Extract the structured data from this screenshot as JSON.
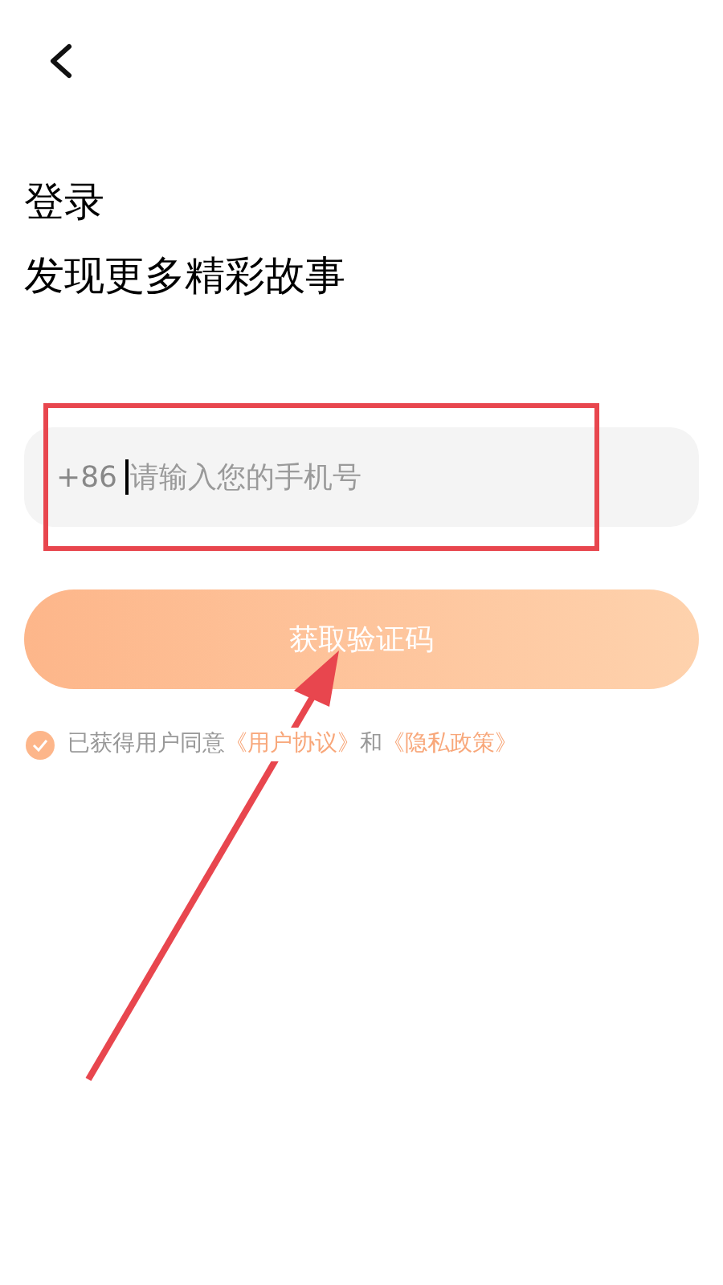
{
  "title": "登录",
  "subtitle": "发现更多精彩故事",
  "phone_field": {
    "prefix": "+86",
    "placeholder": "请输入您的手机号"
  },
  "submit_button": {
    "label": "获取验证码"
  },
  "agreement": {
    "checked": true,
    "parts": [
      {
        "kind": "text",
        "text": "已获得用户同意"
      },
      {
        "kind": "link",
        "text": "《用户协议》"
      },
      {
        "kind": "text",
        "text": "和"
      },
      {
        "kind": "link",
        "text": "《隐私政策》"
      }
    ]
  }
}
